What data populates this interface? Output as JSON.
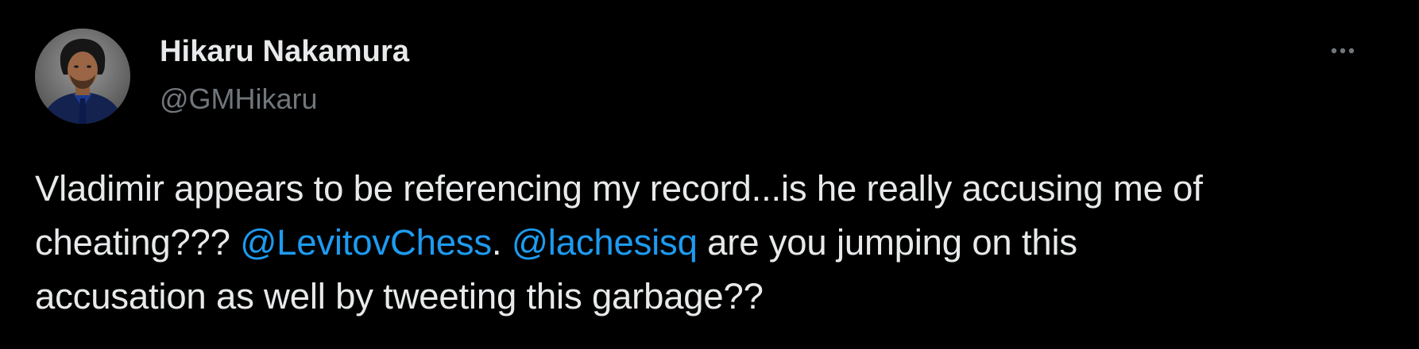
{
  "colors": {
    "background": "#000000",
    "text_primary": "#e7e9ea",
    "text_secondary": "#71767b",
    "mention": "#1d9bf0"
  },
  "author": {
    "display_name": "Hikaru Nakamura",
    "handle": "@GMHikaru",
    "avatar_icon": "profile-photo"
  },
  "more_icon": "more-horizontal-icon",
  "tweet": {
    "line1": "Vladimir appears to be referencing my record...is he really accusing me of",
    "line2_prefix": "cheating??? ",
    "mention1": "@LevitovChess",
    "line2_sep": ". ",
    "mention2": "@lachesisq",
    "line2_suffix": " are you jumping on this",
    "line3": "accusation as well by tweeting this garbage??"
  }
}
